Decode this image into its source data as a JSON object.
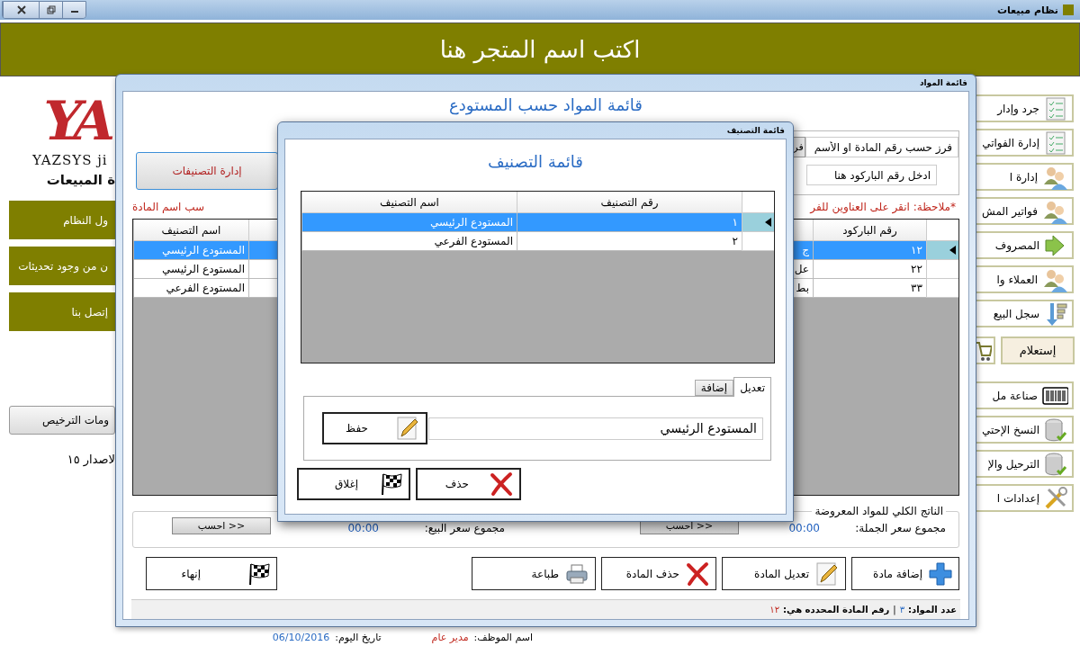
{
  "app": {
    "title": "نظام مبيعات",
    "store_name": "اكتب اسم المتجر هنا",
    "brand": {
      "logo": "YA",
      "name": "YAZSYS ji",
      "subtitle": "ة المبيعات"
    },
    "left_menu": [
      {
        "label": "ول النظام"
      },
      {
        "label": "ن من وجود تحديثات"
      },
      {
        "label": "إتصل بنا"
      }
    ],
    "license_button": "ومات الترخيص",
    "version": "لاصدار ١٥",
    "sidebar": [
      {
        "kind": "button",
        "label": "جرد وإدار"
      },
      {
        "kind": "button",
        "label": "إدارة الفواتي"
      },
      {
        "kind": "button",
        "label": "إدارة ا"
      },
      {
        "kind": "button",
        "label": "فواتير المش"
      },
      {
        "kind": "button",
        "label": "المصروف"
      },
      {
        "kind": "button",
        "label": "العملاء وا"
      },
      {
        "kind": "button",
        "label": "سجل البيع"
      },
      {
        "kind": "inquiry",
        "label": "إستعلام"
      },
      {
        "kind": "button",
        "label": "صناعة مل"
      },
      {
        "kind": "button",
        "label": "النسخ الإحتي"
      },
      {
        "kind": "button",
        "label": "الترحيل والإ"
      },
      {
        "kind": "button",
        "label": "إعدادات ا"
      }
    ],
    "status": [
      {
        "label": "اسم الموظف:",
        "value": "مدير عام"
      },
      {
        "label": "تاريخ اليوم:",
        "value": "06/10/2016"
      }
    ]
  },
  "materials_window": {
    "title": "قائمة المواد",
    "heading": "قائمة المواد حسب المستودع",
    "categories_button": "إدارة التصنيفات",
    "sort_field": {
      "value": "فرز حسب رقم المادة او الأسم"
    },
    "sort_button": "فر",
    "barcode_field": {
      "placeholder": "ادخل رقم الباركود هنا"
    },
    "note": [
      "*ملاحظة: انقر على العناوين للفر",
      "سب اسم المادة"
    ],
    "table": {
      "columns": [
        "رقم الباركود",
        "",
        "اسم التصنيف"
      ],
      "rows": [
        {
          "selected": true,
          "cells": [
            "١٢",
            "ج",
            "المستودع الرئيسي"
          ]
        },
        {
          "selected": false,
          "cells": [
            "٢٢",
            "عل",
            "المستودع الرئيسي"
          ]
        },
        {
          "selected": false,
          "cells": [
            "٣٣",
            "بط",
            "المستودع الفرعي"
          ]
        }
      ]
    },
    "totals": {
      "title": "الناتج الكلي للمواد المعروضة",
      "items": [
        {
          "label": "مجموع سعر الجملة:",
          "value": "00:00",
          "button": "<< احسب"
        },
        {
          "label": "مجموع سعر البيع:",
          "value": "00:00",
          "button": "<< احسب"
        }
      ]
    },
    "buttons": [
      "إضافة مادة",
      "تعديل المادة",
      "حذف المادة",
      "طباعة",
      "إنهاء"
    ],
    "status_bar": {
      "count_label": "عدد المواد:",
      "count": "٣",
      "separator": "|",
      "selected_label": "رقم المادة المحدده هي:",
      "selected_value": "١٢"
    }
  },
  "category_dialog": {
    "title": "قائمة التصنيف",
    "heading": "قائمة  التصنيف",
    "table": {
      "columns": [
        "رقم التصنيف",
        "اسم التصنيف"
      ],
      "rows": [
        {
          "selected": true,
          "cells": [
            "١",
            "المستودع الرئيسي"
          ]
        },
        {
          "selected": false,
          "cells": [
            "٢",
            "المستودع الفرعي"
          ]
        }
      ]
    },
    "tabs": [
      {
        "label": "تعديل",
        "selected": true
      },
      {
        "label": "إضافة",
        "selected": false
      }
    ],
    "name_field": {
      "value": "المستودع الرئيسي"
    },
    "save_button": "حفظ",
    "buttons": [
      "حذف",
      "إغلاق"
    ]
  }
}
